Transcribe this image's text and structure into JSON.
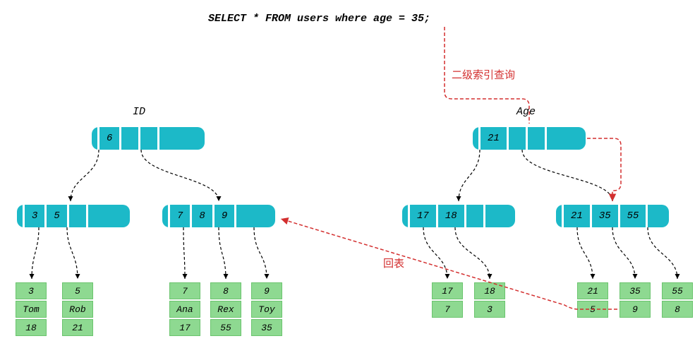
{
  "sql": "SELECT * FROM users where age = 35;",
  "labels": {
    "id": "ID",
    "age": "Age"
  },
  "annotations": {
    "secondary": "二级索引查询",
    "backtable": "回表"
  },
  "left_tree": {
    "root": [
      "6"
    ],
    "level2_a": [
      "3",
      "5"
    ],
    "level2_b": [
      "7",
      "8",
      "9"
    ],
    "leaves": [
      {
        "id": "3",
        "name": "Tom",
        "age": "18"
      },
      {
        "id": "5",
        "name": "Rob",
        "age": "21"
      },
      {
        "id": "7",
        "name": "Ana",
        "age": "17"
      },
      {
        "id": "8",
        "name": "Rex",
        "age": "55"
      },
      {
        "id": "9",
        "name": "Toy",
        "age": "35"
      }
    ]
  },
  "right_tree": {
    "root": [
      "21"
    ],
    "level2_a": [
      "17",
      "18"
    ],
    "level2_b": [
      "21",
      "35",
      "55"
    ],
    "leaves": [
      {
        "k": "17",
        "v": "7"
      },
      {
        "k": "18",
        "v": "3"
      },
      {
        "k": "21",
        "v": "5"
      },
      {
        "k": "35",
        "v": "9"
      },
      {
        "k": "55",
        "v": "8"
      }
    ]
  }
}
